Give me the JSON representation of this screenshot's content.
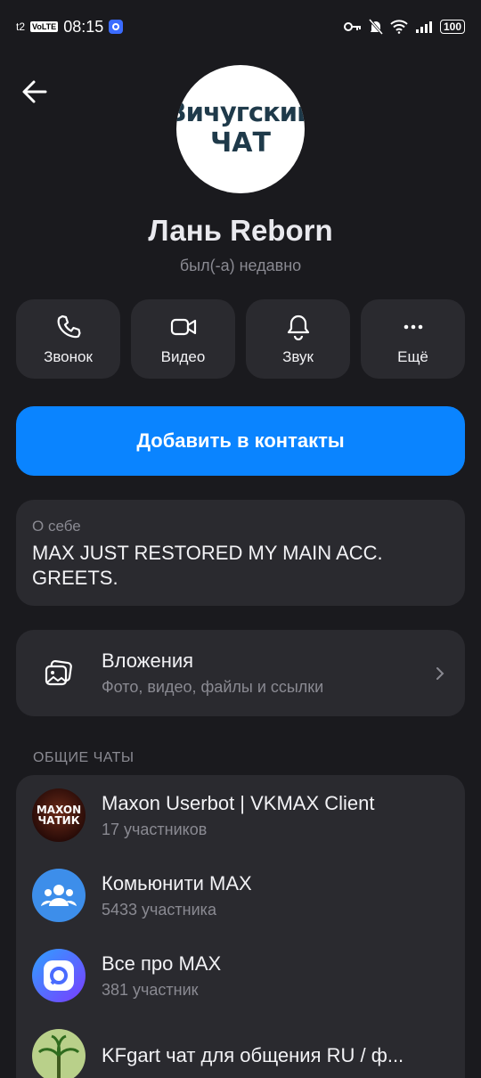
{
  "status_bar": {
    "carrier": "t2",
    "volte": "VoLTE",
    "time": "08:15",
    "battery": "100"
  },
  "profile": {
    "avatar_line1": "Вичугский",
    "avatar_line2": "ЧАТ",
    "name": "Лань Reborn",
    "status": "был(-а) недавно"
  },
  "actions": [
    {
      "label": "Звонок",
      "icon": "phone-icon"
    },
    {
      "label": "Видео",
      "icon": "video-camera-icon"
    },
    {
      "label": "Звук",
      "icon": "bell-icon"
    },
    {
      "label": "Ещё",
      "icon": "more-dots-icon"
    }
  ],
  "add_contact_label": "Добавить в контакты",
  "about": {
    "label": "О себе",
    "text": "MAX JUST RESTORED MY MAIN ACC. GREETS."
  },
  "attachments": {
    "title": "Вложения",
    "subtitle": "Фото, видео, файлы и ссылки"
  },
  "common_chats": {
    "header": "ОБЩИЕ ЧАТЫ",
    "items": [
      {
        "name": "Maxon Userbot | VKMAX Client",
        "members": "17 участников",
        "avatar_text1": "MAXON",
        "avatar_text2": "ЧАТИК"
      },
      {
        "name": "Комьюнити MAX",
        "members": "5433 участника"
      },
      {
        "name": "Все про MAX",
        "members": "381 участник"
      },
      {
        "name": "KFgart чат для общения RU / ф...",
        "members": ""
      }
    ]
  },
  "colors": {
    "background": "#1a1a1e",
    "card": "#2a2a2f",
    "accent": "#0a84ff",
    "secondary_text": "#8a8a92"
  }
}
